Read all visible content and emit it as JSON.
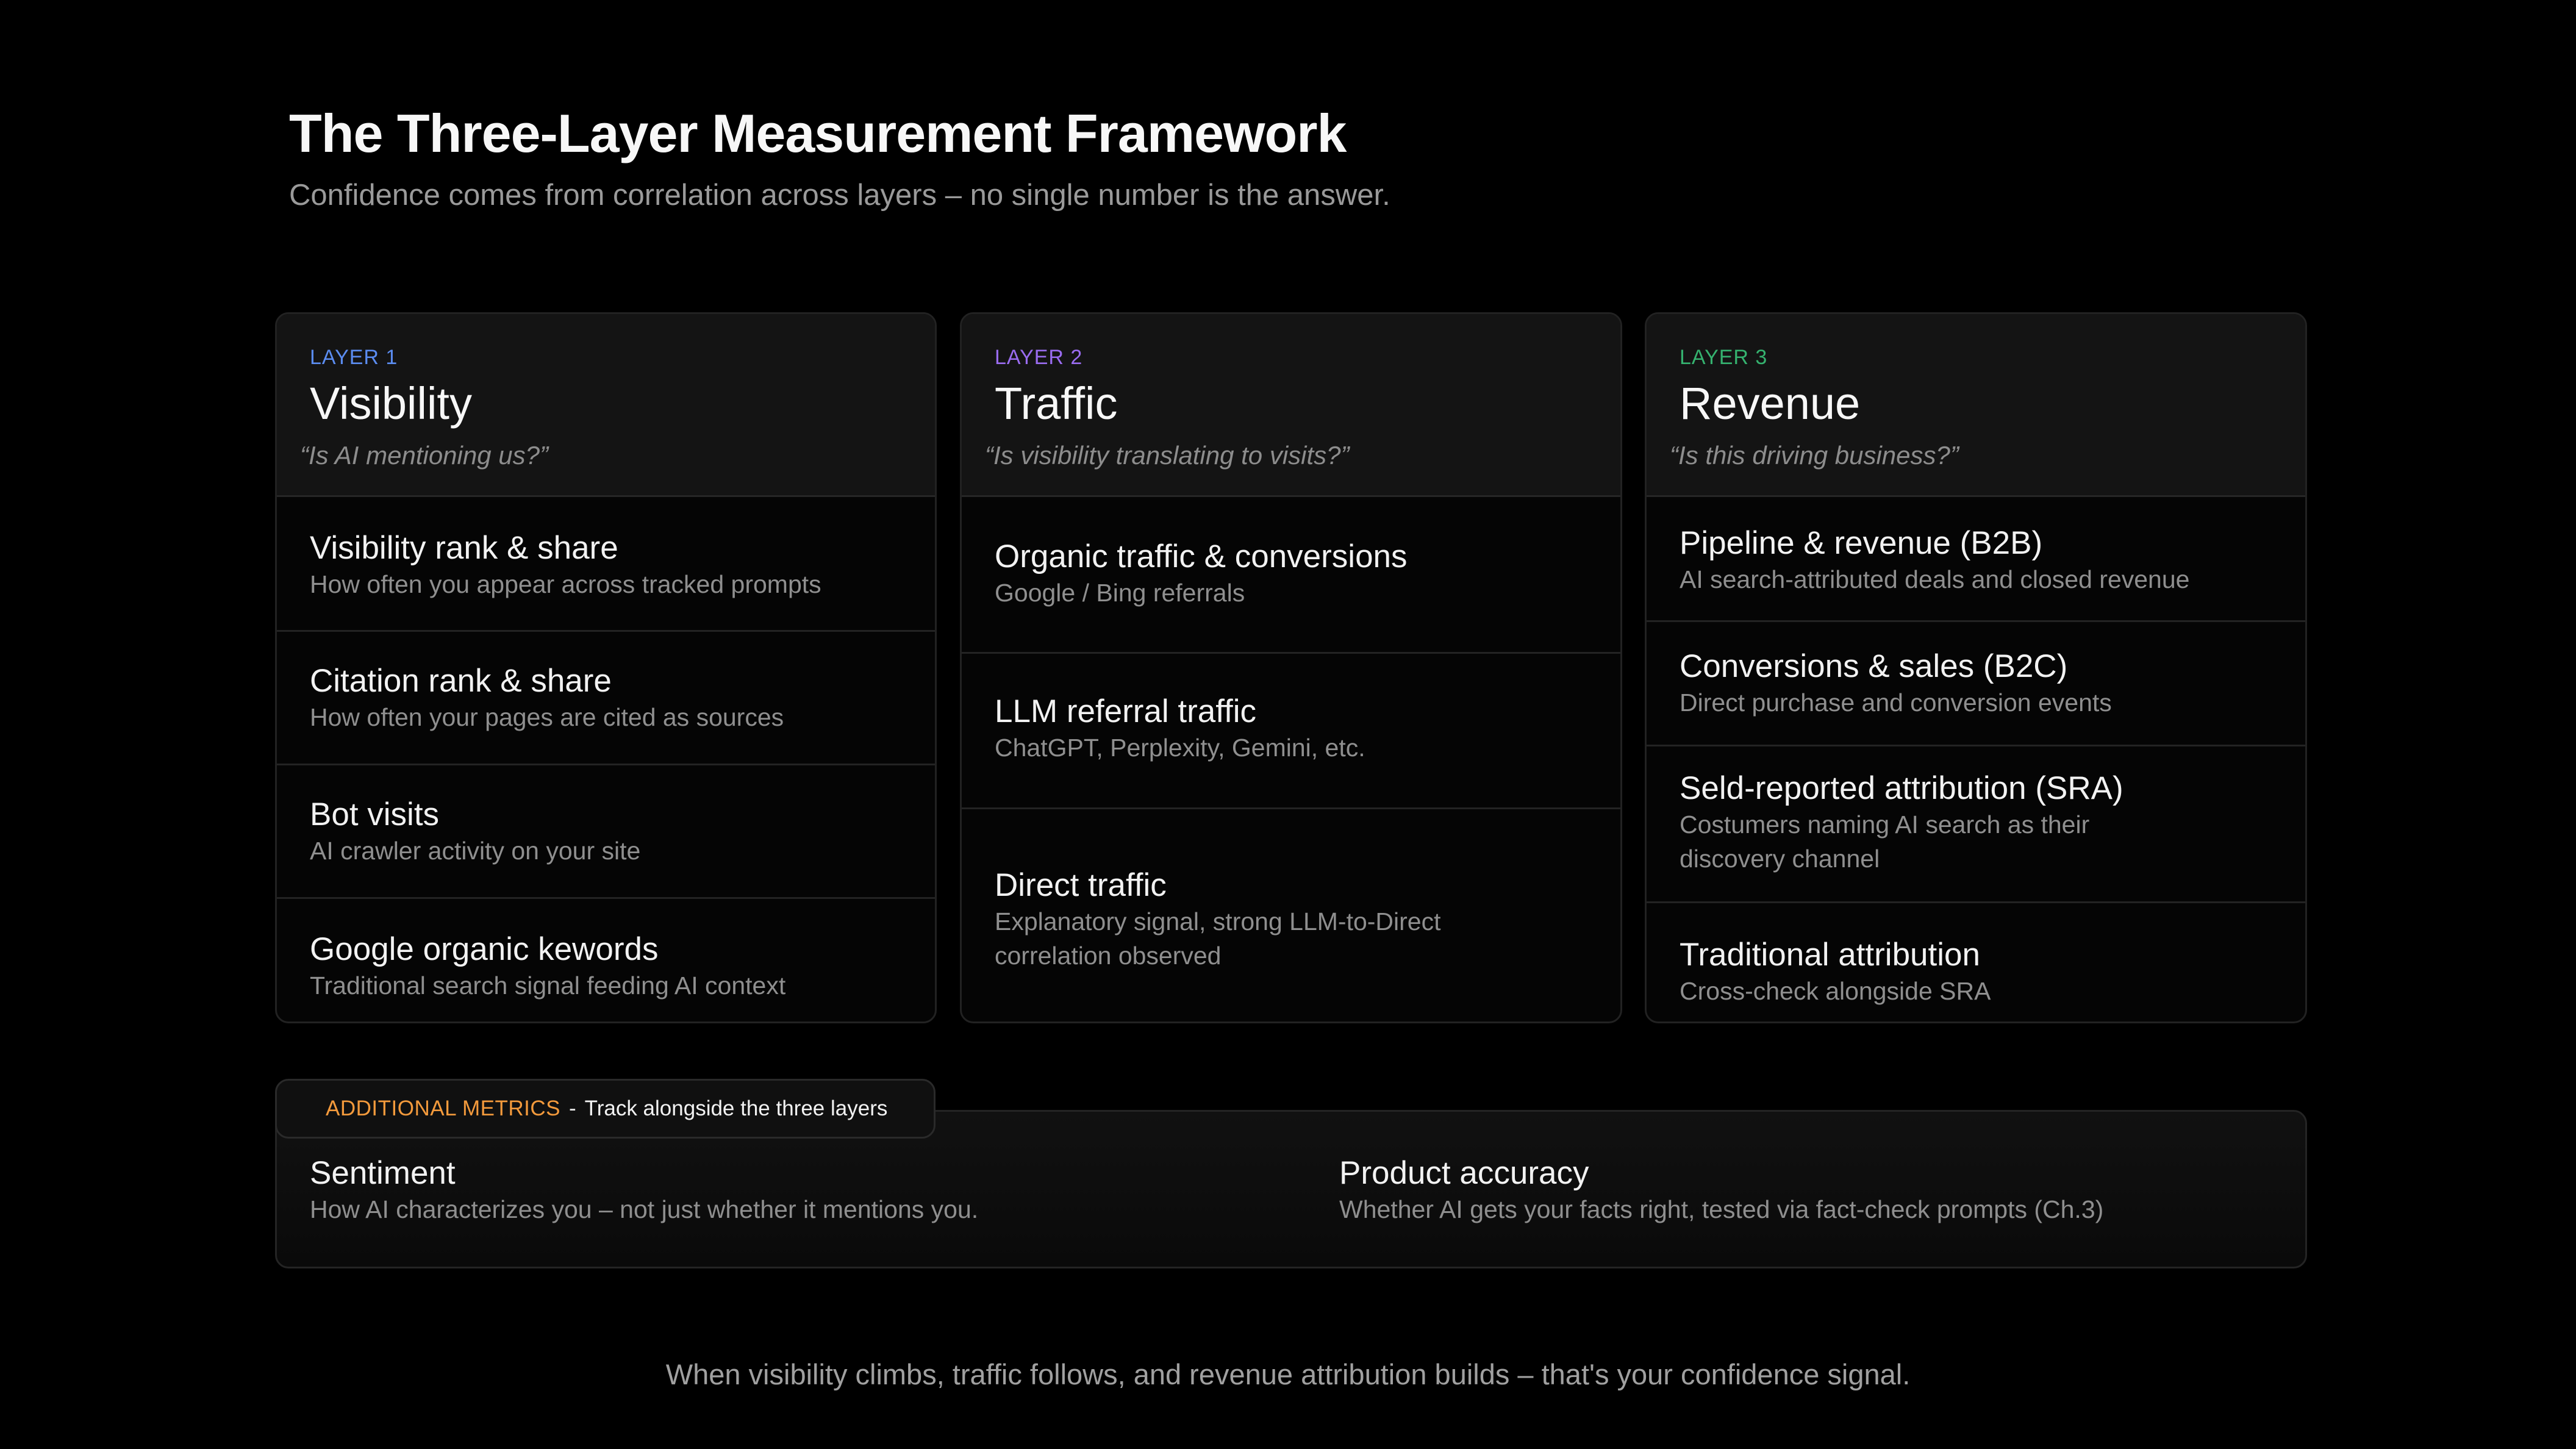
{
  "header": {
    "title": "The Three-Layer Measurement Framework",
    "subtitle": "Confidence comes from correlation across layers – no single number is the answer."
  },
  "colors": {
    "layer1": "#5b8cf0",
    "layer2": "#9a6cf0",
    "layer3": "#35b26f",
    "additional": "#f39a3c"
  },
  "layers": [
    {
      "label": "LAYER 1",
      "name": "Visibility",
      "question": "“Is AI mentioning us?”",
      "rows": [
        {
          "title": "Visibility rank & share",
          "desc": "How often you appear across tracked prompts"
        },
        {
          "title": "Citation rank & share",
          "desc": "How often your pages are cited as sources"
        },
        {
          "title": "Bot visits",
          "desc": "AI crawler activity on your site"
        },
        {
          "title": "Google organic kewords",
          "desc": "Traditional search signal feeding AI context"
        }
      ]
    },
    {
      "label": "LAYER 2",
      "name": "Traffic",
      "question": "“Is visibility translating to visits?”",
      "rows": [
        {
          "title": "Organic traffic & conversions",
          "desc": "Google / Bing referrals"
        },
        {
          "title": "LLM referral traffic",
          "desc": "ChatGPT, Perplexity, Gemini, etc."
        },
        {
          "title": "Direct traffic",
          "desc": "Explanatory signal, strong LLM-to-Direct correlation observed"
        }
      ]
    },
    {
      "label": "LAYER 3",
      "name": "Revenue",
      "question": "“Is this driving business?”",
      "rows": [
        {
          "title": "Pipeline & revenue (B2B)",
          "desc": "AI search-attributed deals and closed revenue"
        },
        {
          "title": "Conversions & sales (B2C)",
          "desc": "Direct purchase and conversion events"
        },
        {
          "title": "Seld-reported attribution (SRA)",
          "desc": "Costumers naming AI search as their discovery channel"
        },
        {
          "title": "Traditional attribution",
          "desc": "Cross-check alongside SRA"
        }
      ]
    }
  ],
  "additional": {
    "tag": "ADDITIONAL METRICS",
    "separator": "-",
    "note": "Track alongside the three layers",
    "metrics": [
      {
        "title": "Sentiment",
        "desc": "How AI characterizes you – not just whether it mentions you."
      },
      {
        "title": "Product accuracy",
        "desc": "Whether AI gets your facts right, tested via fact-check prompts (Ch.3)"
      }
    ]
  },
  "footer": {
    "text": "When visibility climbs, traffic follows, and revenue attribution builds – that's your confidence signal."
  }
}
